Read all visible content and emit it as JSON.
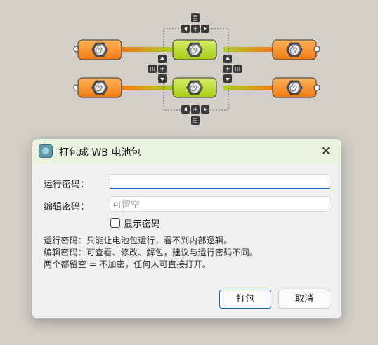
{
  "dialog": {
    "title": "打包成 WB 电池包",
    "close_glyph": "✕",
    "run_password_label": "运行密码：",
    "run_password_value": "",
    "edit_password_label": "编辑密码：",
    "edit_password_placeholder": "可留空",
    "show_password_label": "显示密码",
    "show_password_checked": false,
    "help_lines": [
      "运行密码：只能让电池包运行，看不到内部逻辑。",
      "编辑密码：可查看、修改、解包，建议与运行密码不同。",
      "两个都留空 = 不加密，任何人可直接打开。"
    ],
    "ok_label": "打包",
    "cancel_label": "取消",
    "accent_color": "#1c63b6"
  },
  "canvas": {
    "component_icon": "spiral-icon",
    "component_colors": {
      "orange": "#f7941d",
      "green": "#b5d62a"
    },
    "control_icons": [
      "list-icon",
      "arrow-left-icon",
      "arrow-plus-icon",
      "arrow-right-icon",
      "arrow-up-icon",
      "arrow-down-icon"
    ]
  }
}
